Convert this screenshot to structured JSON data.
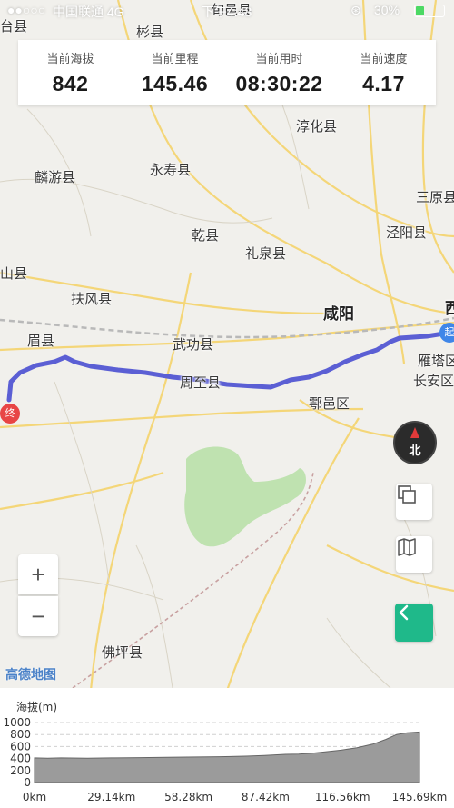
{
  "status_bar": {
    "carrier": "中国联通 4G",
    "time": "下午4:48",
    "battery_percent": "30%",
    "battery_level": 0.3
  },
  "stats": [
    {
      "label": "当前海拔",
      "value": "842"
    },
    {
      "label": "当前里程",
      "value": "145.46"
    },
    {
      "label": "当前用时",
      "value": "08:30:22"
    },
    {
      "label": "当前速度",
      "value": "4.17"
    }
  ],
  "map": {
    "places": {
      "taixian": "台县",
      "binxian": "彬县",
      "xunyi": "旬邑县",
      "chunhua": "淳化县",
      "linyou": "麟游县",
      "yongshou": "永寿县",
      "sanyuan": "三原县",
      "qianxian": "乾县",
      "jingyang": "泾阳县",
      "liquan": "礼泉县",
      "shan": "山县",
      "fufeng": "扶风县",
      "xianyang": "咸阳",
      "xi": "西",
      "meixian": "眉县",
      "wugong": "武功县",
      "yanta": "雁塔区",
      "zhouzhi": "周至县",
      "changan": "长安区",
      "huyi": "鄠邑区",
      "foping": "佛坪县"
    },
    "marker_start": "起",
    "marker_end": "终",
    "compass": "北",
    "zoom_in": "+",
    "zoom_out": "−",
    "logo": "高德地图",
    "route_color": "#5b5fd4"
  },
  "chart_data": {
    "type": "area",
    "title": "",
    "ylabel": "海拔(m)",
    "xlabel": "",
    "x_tick_labels": [
      "0km",
      "29.14km",
      "58.28km",
      "87.42km",
      "116.56km",
      "145.69km"
    ],
    "y_tick_labels": [
      "1000",
      "800",
      "600",
      "400",
      "200",
      "0"
    ],
    "ylim": [
      0,
      1000
    ],
    "xlim": [
      0,
      145.69
    ],
    "grid": true,
    "series": [
      {
        "x": [
          0,
          5,
          10,
          20,
          29,
          40,
          50,
          58,
          70,
          80,
          87,
          95,
          100,
          105,
          110,
          116,
          122,
          128,
          133,
          137,
          141,
          145.69
        ],
        "values": [
          410,
          405,
          410,
          405,
          410,
          415,
          420,
          425,
          430,
          440,
          450,
          470,
          475,
          490,
          510,
          540,
          580,
          640,
          720,
          800,
          830,
          842
        ]
      }
    ]
  }
}
